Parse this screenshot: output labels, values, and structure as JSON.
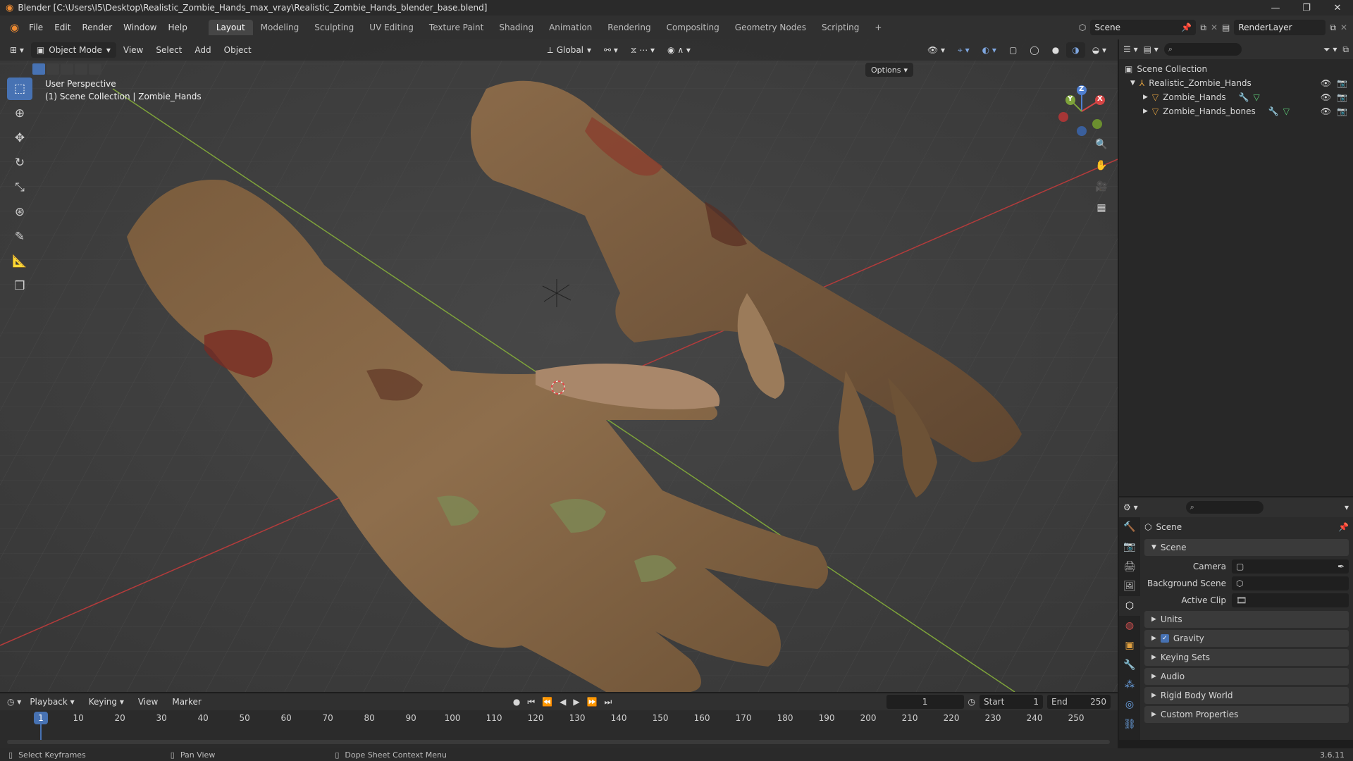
{
  "window": {
    "title": "Blender [C:\\Users\\I5\\Desktop\\Realistic_Zombie_Hands_max_vray\\Realistic_Zombie_Hands_blender_base.blend]",
    "minimize": "—",
    "maximize": "❐",
    "close": "✕"
  },
  "menu": [
    "File",
    "Edit",
    "Render",
    "Window",
    "Help"
  ],
  "workspaces": [
    "Layout",
    "Modeling",
    "Sculpting",
    "UV Editing",
    "Texture Paint",
    "Shading",
    "Animation",
    "Rendering",
    "Compositing",
    "Geometry Nodes",
    "Scripting"
  ],
  "workspace_add": "+",
  "scene_name": "Scene",
  "render_layer": "RenderLayer",
  "viewport": {
    "mode": "Object Mode",
    "menus": [
      "View",
      "Select",
      "Add",
      "Object"
    ],
    "transform_orientation": "Global",
    "options_label": "Options",
    "overlay_title": "User Perspective",
    "overlay_subtitle": "(1) Scene Collection | Zombie_Hands",
    "gizmo": {
      "x": "X",
      "y": "Y",
      "z": "Z"
    }
  },
  "outliner": {
    "root": "Scene Collection",
    "collection": "Realistic_Zombie_Hands",
    "objects": [
      "Zombie_Hands",
      "Zombie_Hands_bones"
    ]
  },
  "properties": {
    "context_label": "Scene",
    "panel_scene": "Scene",
    "fields": [
      {
        "label": "Camera",
        "value": ""
      },
      {
        "label": "Background Scene",
        "value": ""
      },
      {
        "label": "Active Clip",
        "value": ""
      }
    ],
    "panels": [
      "Units",
      "Gravity",
      "Keying Sets",
      "Audio",
      "Rigid Body World",
      "Custom Properties"
    ],
    "gravity_checked": true
  },
  "timeline": {
    "menus": [
      "Playback",
      "Keying",
      "View",
      "Marker"
    ],
    "current_frame": "1",
    "start_label": "Start",
    "start_value": "1",
    "end_label": "End",
    "end_value": "250",
    "frame_ticks": [
      "1",
      "10",
      "20",
      "30",
      "40",
      "50",
      "60",
      "70",
      "80",
      "90",
      "100",
      "110",
      "120",
      "130",
      "140",
      "150",
      "160",
      "170",
      "180",
      "190",
      "200",
      "210",
      "220",
      "230",
      "240",
      "250"
    ]
  },
  "status": {
    "left": "Select Keyframes",
    "middle": "Pan View",
    "right": "Dope Sheet Context Menu",
    "version": "3.6.11"
  },
  "colors": {
    "accent": "#4772b3",
    "grid_x_axis": "#b43b3b",
    "grid_y_axis": "#7ea33a",
    "skin": "#8a6a49"
  }
}
